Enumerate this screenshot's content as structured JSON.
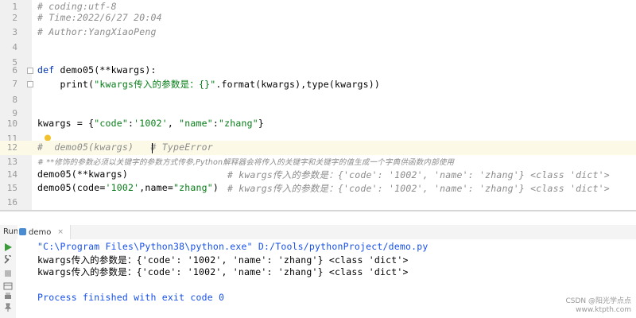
{
  "editor": {
    "lines": [
      {
        "n": "1",
        "text": "# coding:utf-8"
      },
      {
        "n": "2",
        "text": "# Time:2022/6/27 20:04"
      },
      {
        "n": "3",
        "text": "# Author:YangXiaoPeng"
      },
      {
        "n": "4",
        "text": ""
      },
      {
        "n": "5",
        "text": ""
      },
      {
        "n": "6",
        "parts": [
          "def",
          " demo05(**kwargs):"
        ]
      },
      {
        "n": "7",
        "parts": [
          "    print(",
          "\"kwargs传入的参数是：{}\"",
          ".format(kwargs),type(kwargs))"
        ]
      },
      {
        "n": "8",
        "text": ""
      },
      {
        "n": "9",
        "text": ""
      },
      {
        "n": "10",
        "parts": [
          "kwargs = {",
          "\"code\"",
          ":",
          "'1002'",
          ", ",
          "\"name\"",
          ":",
          "\"zhang\"",
          "}"
        ]
      },
      {
        "n": "11",
        "text": ""
      },
      {
        "n": "12",
        "text": "#  demo05(kwargs)   # TypeError"
      },
      {
        "n": "13",
        "text": "# **修饰的参数必须以关键字的参数方式传参,Python解释器会将传入的关键字和关键字的值生成一个字典供函数内部使用"
      },
      {
        "n": "14",
        "code": "demo05(**kwargs)",
        "comment": "# kwargs传入的参数是：{'code': '1002', 'name': 'zhang'} <class 'dict'>"
      },
      {
        "n": "15",
        "parts": [
          "demo05(code=",
          "'1002'",
          ",name=",
          "\"zhang\"",
          ")"
        ],
        "comment": "# kwargs传入的参数是：{'code': '1002', 'name': 'zhang'} <class 'dict'>"
      },
      {
        "n": "16",
        "text": ""
      }
    ]
  },
  "run": {
    "label": "Run:",
    "tab": "demo",
    "close": "×"
  },
  "console": {
    "command": "\"C:\\Program Files\\Python38\\python.exe\" D:/Tools/pythonProject/demo.py",
    "out1": "kwargs传入的参数是：{'code': '1002', 'name': 'zhang'} <class 'dict'>",
    "out2": "kwargs传入的参数是：{'code': '1002', 'name': 'zhang'} <class 'dict'>",
    "exit": "Process finished with exit code 0"
  },
  "watermark": {
    "line1": "CSDN @阳光学点点",
    "line2": "www.ktpth.com"
  },
  "colors": {
    "keyword": "#0033b3",
    "string": "#067d17",
    "comment": "#8c8c8c",
    "link": "#1750eb",
    "highlight": "#fcfae6"
  }
}
